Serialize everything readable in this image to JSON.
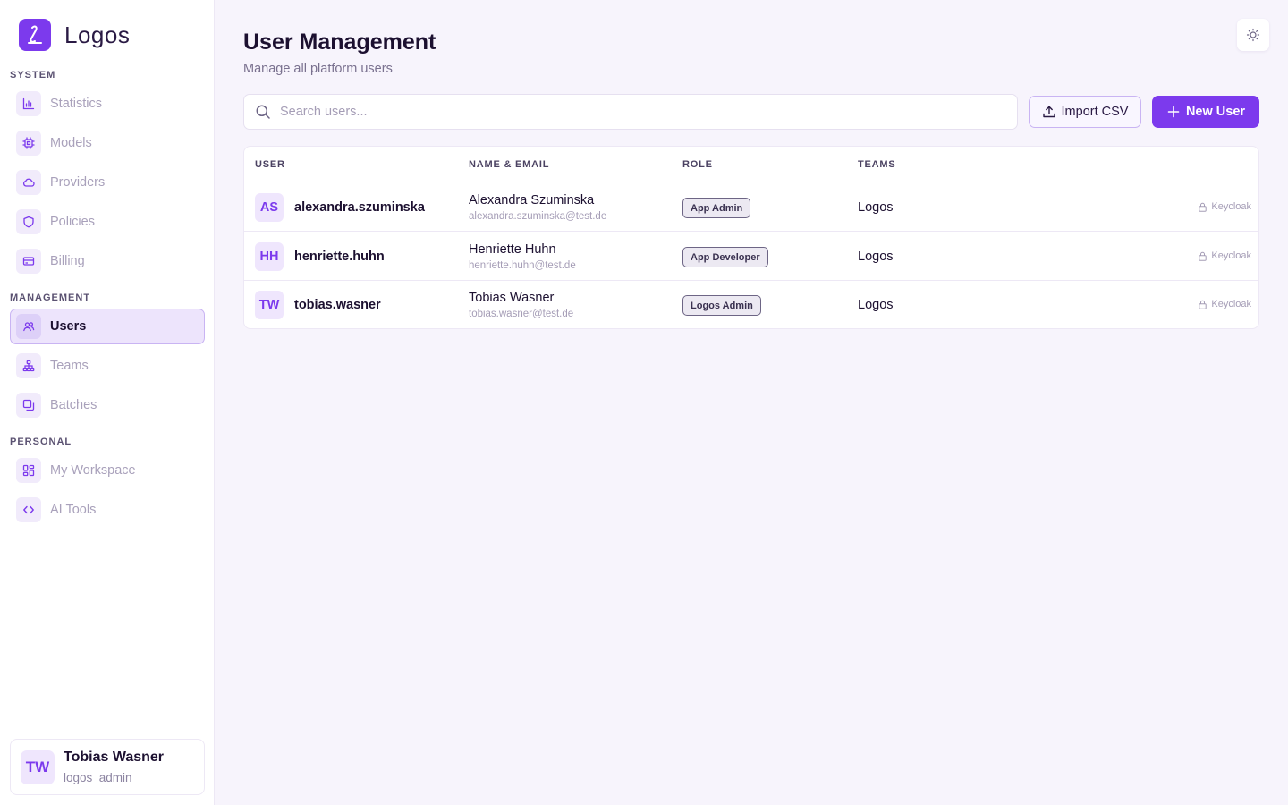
{
  "brand": {
    "name": "Logos"
  },
  "sidebar": {
    "sections": {
      "system": "SYSTEM",
      "management": "MANAGEMENT",
      "personal": "PERSONAL"
    },
    "items": {
      "statistics": "Statistics",
      "models": "Models",
      "providers": "Providers",
      "policies": "Policies",
      "billing": "Billing",
      "users": "Users",
      "teams": "Teams",
      "batches": "Batches",
      "workspace": "My Workspace",
      "ai_tools": "AI Tools"
    },
    "active_item": "Users"
  },
  "current_user": {
    "initials": "TW",
    "name": "Tobias Wasner",
    "role": "logos_admin"
  },
  "page": {
    "title": "User Management",
    "subtitle": "Manage all platform users"
  },
  "search": {
    "placeholder": "Search users...",
    "value": ""
  },
  "actions": {
    "import_label": "Import CSV",
    "new_label": "New User"
  },
  "table": {
    "headers": {
      "user": "USER",
      "name_email": "NAME & EMAIL",
      "role": "ROLE",
      "teams": "TEAMS"
    },
    "rows": [
      {
        "initials": "AS",
        "username": "alexandra.szuminska",
        "name": "Alexandra Szuminska",
        "email": "alexandra.szuminska@test.de",
        "role": "App Admin",
        "team": "Logos",
        "auth": "Keycloak"
      },
      {
        "initials": "HH",
        "username": "henriette.huhn",
        "name": "Henriette Huhn",
        "email": "henriette.huhn@test.de",
        "role": "App Developer",
        "team": "Logos",
        "auth": "Keycloak"
      },
      {
        "initials": "TW",
        "username": "tobias.wasner",
        "name": "Tobias Wasner",
        "email": "tobias.wasner@test.de",
        "role": "Logos Admin",
        "team": "Logos",
        "auth": "Keycloak"
      }
    ]
  },
  "colors": {
    "accent": "#7c3aed",
    "accent_soft": "#efe6fd",
    "background": "#f7f4fc",
    "text": "#1c1030",
    "muted": "#a59db6"
  },
  "icons": {
    "brand": "logos-logo-icon",
    "statistics": "bar-chart-icon",
    "models": "chip-icon",
    "providers": "cloud-icon",
    "policies": "shield-icon",
    "billing": "credit-card-icon",
    "users": "users-icon",
    "teams": "sitemap-icon",
    "batches": "layers-icon",
    "workspace": "grid-icon",
    "ai_tools": "code-icon",
    "theme": "sun-icon",
    "search": "search-icon",
    "import": "upload-icon",
    "new": "plus-icon",
    "auth": "lock-icon"
  }
}
